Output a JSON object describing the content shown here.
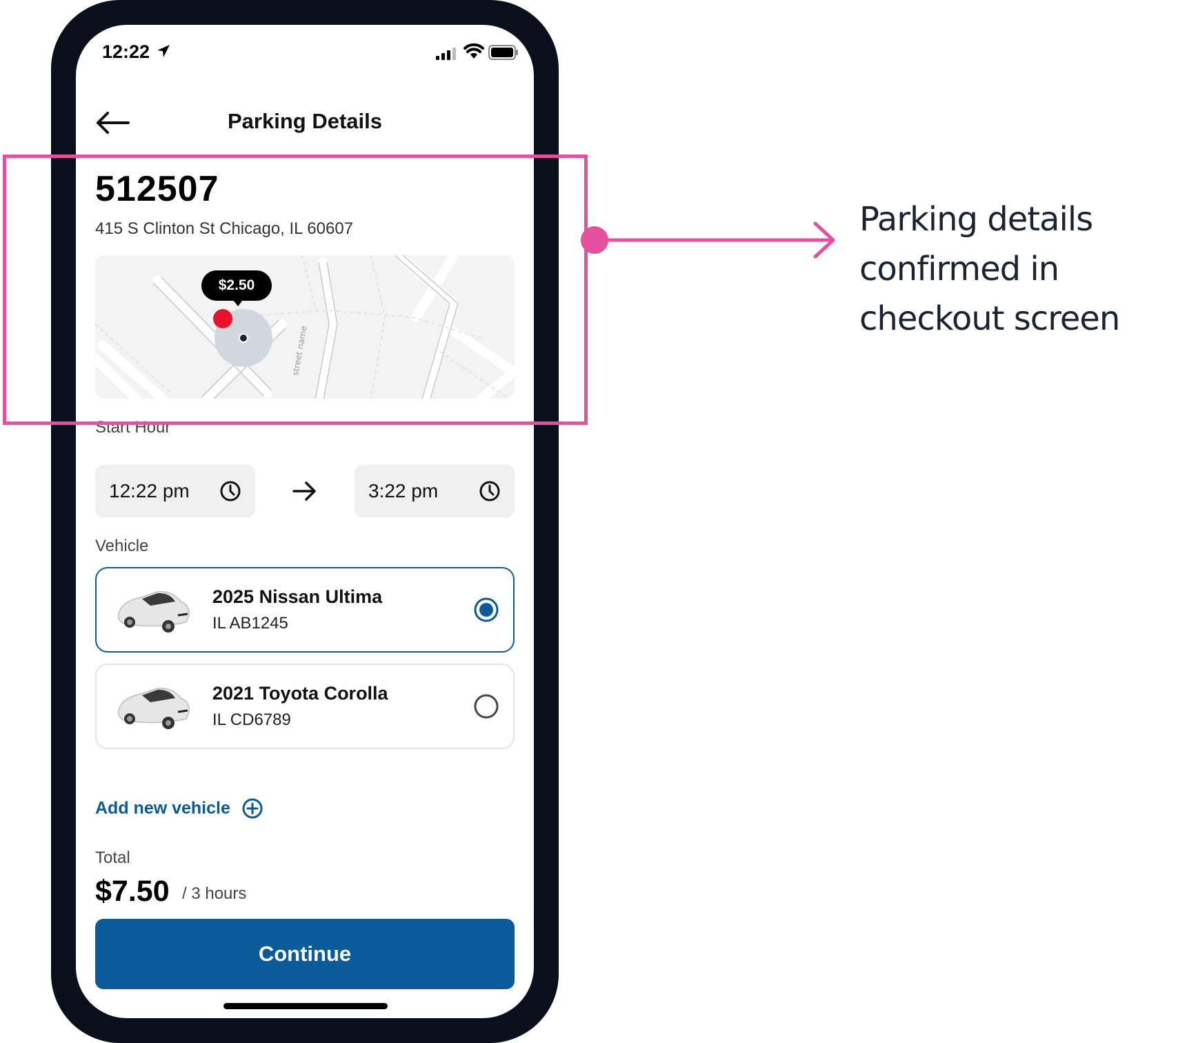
{
  "status_bar": {
    "time": "12:22"
  },
  "header": {
    "title": "Parking Details"
  },
  "lot": {
    "number": "512507",
    "address": "415 S Clinton St Chicago, IL 60607"
  },
  "map": {
    "price": "$2.50",
    "street_label": "street name"
  },
  "schedule": {
    "label": "Start Hour",
    "start": "12:22 pm",
    "end": "3:22 pm"
  },
  "vehicles": {
    "label": "Vehicle",
    "items": [
      {
        "name": "2025 Nissan Ultima",
        "plate": "IL AB1245",
        "selected": true
      },
      {
        "name": "2021 Toyota Corolla",
        "plate": "IL CD6789",
        "selected": false
      }
    ],
    "add_label": "Add new vehicle"
  },
  "total": {
    "label": "Total",
    "amount": "$7.50",
    "duration": "/ 3 hours"
  },
  "continue_label": "Continue",
  "annotation": {
    "text": "Parking details confirmed in checkout screen"
  },
  "colors": {
    "primary": "#0b5a9a",
    "highlight": "#e64ea0",
    "pin": "#e8132b",
    "frame": "#0b0f1c"
  }
}
